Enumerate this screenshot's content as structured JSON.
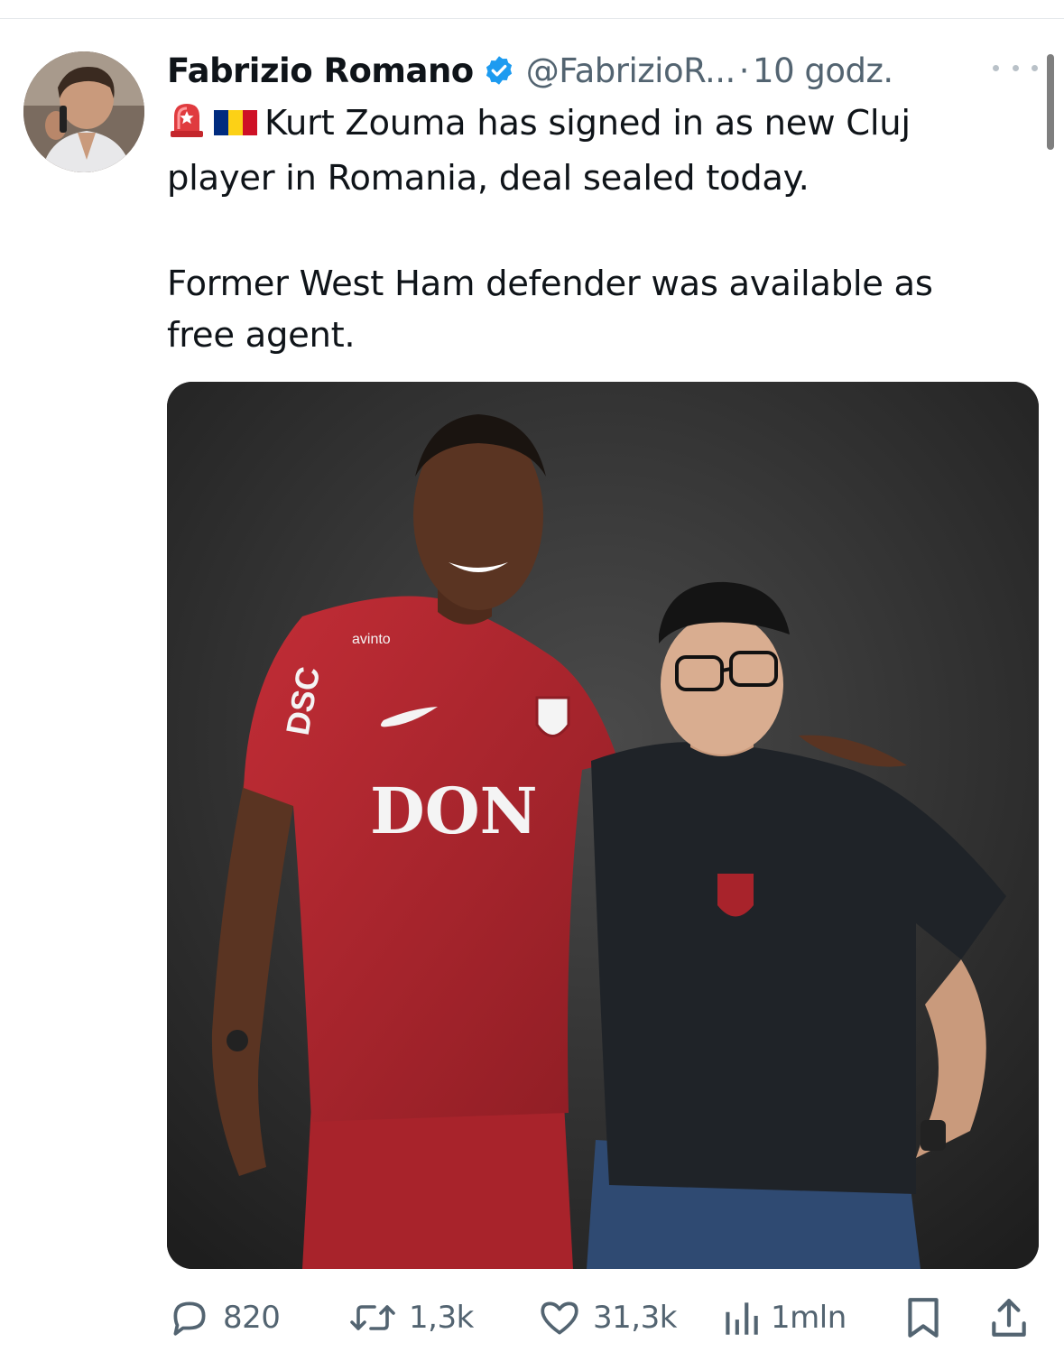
{
  "tweet": {
    "author": {
      "display_name": "Fabrizio Romano",
      "handle": "@FabrizioR...",
      "separator": "·",
      "time": "10 godz.",
      "verified": true,
      "avatar_icon": "profile-photo"
    },
    "text": {
      "line1_emojis": [
        "siren-emoji",
        "romania-flag-emoji"
      ],
      "paragraph1": "Kurt Zouma has signed in as new Cluj\nplayer in Romania, deal sealed today.",
      "paragraph2": "Former West Ham defender was available as\nfree agent."
    },
    "media": {
      "shirt_sponsor": "DON",
      "sleeve_sponsor": "DSC",
      "collar_sponsor": "avinto",
      "kit_color": "#b0262e",
      "backdrop_color": "#2b2b2b"
    },
    "actions": {
      "replies": "820",
      "reposts": "1,3k",
      "likes": "31,3k",
      "views": "1mln"
    }
  },
  "colors": {
    "text_primary": "#0f1419",
    "text_secondary": "#536471",
    "verified_blue": "#1d9bf0"
  }
}
